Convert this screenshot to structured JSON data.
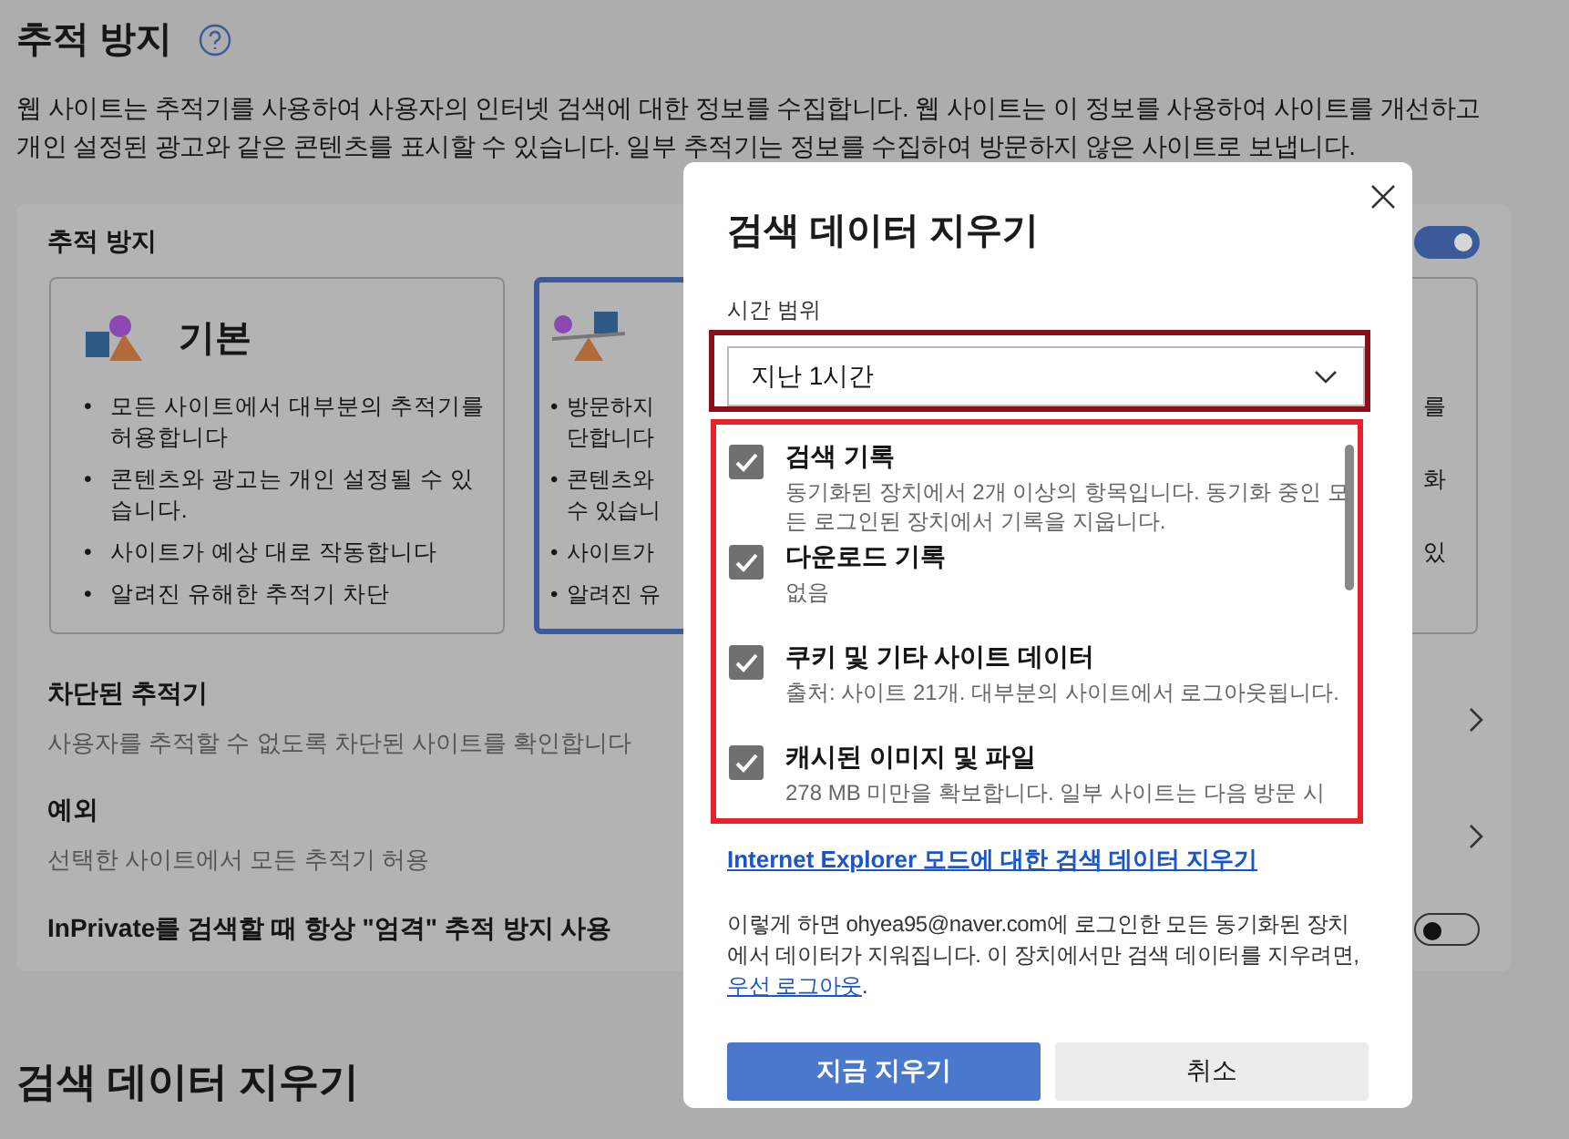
{
  "header": {
    "title": "추적 방지"
  },
  "intro": "웹 사이트는 추적기를 사용하여 사용자의 인터넷 검색에 대한 정보를 수집합니다. 웹 사이트는 이 정보를 사용하여 사이트를 개선하고 개인 설정된 광고와 같은 콘텐츠를 표시할 수 있습니다. 일부 추적기는 정보를 수집하여 방문하지 않은 사이트로 보냅니다.",
  "tracking": {
    "title": "추적 방지",
    "on": true,
    "cards": [
      {
        "title": "기본",
        "selected": false,
        "bullets": [
          {
            "marker": "•",
            "lines": [
              "모든 사이트에서 대부분의 추적기를 허용합니다"
            ]
          },
          {
            "marker": "•",
            "lines": [
              "콘텐츠와 광고는 개인 설정될 수 있습니다."
            ]
          },
          {
            "marker": "•",
            "lines": [
              "사이트가 예상 대로 작동합니다"
            ]
          },
          {
            "marker": "•",
            "lines": [
              "알려진 유해한 추적기 차단"
            ]
          }
        ]
      },
      {
        "selected": true,
        "bullets": [
          {
            "marker": "•",
            "lines": [
              "방문하지",
              "단합니다"
            ]
          },
          {
            "marker": "•",
            "lines": [
              "콘텐츠와",
              "수 있습니"
            ]
          },
          {
            "marker": "•",
            "lines": [
              "사이트가"
            ]
          },
          {
            "marker": "•",
            "lines": [
              "알려진 유"
            ]
          }
        ]
      },
      {
        "selected": false,
        "bullets": [
          {
            "lines": [
              "를"
            ]
          },
          {
            "lines": [
              "화"
            ]
          },
          {
            "lines": [
              "있"
            ]
          }
        ]
      }
    ],
    "settings": [
      {
        "kind": "link",
        "title": "차단된 추적기",
        "description": "사용자를 추적할 수 없도록 차단된 사이트를 확인합니다"
      },
      {
        "kind": "link",
        "title": "예외",
        "description": "선택한 사이트에서 모든 추적기 허용"
      },
      {
        "kind": "toggle",
        "title": "InPrivate를 검색할 때 항상 \"엄격\" 추적 방지 사용",
        "on": false
      }
    ]
  },
  "next_section": {
    "title": "검색 데이터 지우기"
  },
  "dialog": {
    "title": "검색 데이터 지우기",
    "time_range": {
      "label": "시간 범위",
      "value": "지난 1시간"
    },
    "items": [
      {
        "label": "검색 기록",
        "description": "동기화된 장치에서 2개 이상의 항목입니다. 동기화 중인 모든 로그인된 장치에서 기록을 지웁니다.",
        "checked": true
      },
      {
        "label": "다운로드 기록",
        "description": "없음",
        "checked": true
      },
      {
        "label": "쿠키 및 기타 사이트 데이터",
        "description": "출처: 사이트 21개. 대부분의 사이트에서 로그아웃됩니다.",
        "checked": true
      },
      {
        "label": "캐시된 이미지 및 파일",
        "description": "278 MB 미만을 확보합니다. 일부 사이트는 다음 방문 시",
        "checked": true
      }
    ],
    "ie_link": "Internet Explorer 모드에 대한 검색 데이터 지우기",
    "note": {
      "text": "이렇게 하면 ohyea95@naver.com에 로그인한 모든 동기화된 장치에서 데이터가 지워집니다. 이 장치에서만 검색 데이터를 지우려면, ",
      "link": "우선 로그아웃",
      "end": "."
    },
    "buttons": [
      {
        "kind": "primary",
        "label": "지금 지우기"
      },
      {
        "kind": "secondary",
        "label": "취소"
      }
    ]
  }
}
